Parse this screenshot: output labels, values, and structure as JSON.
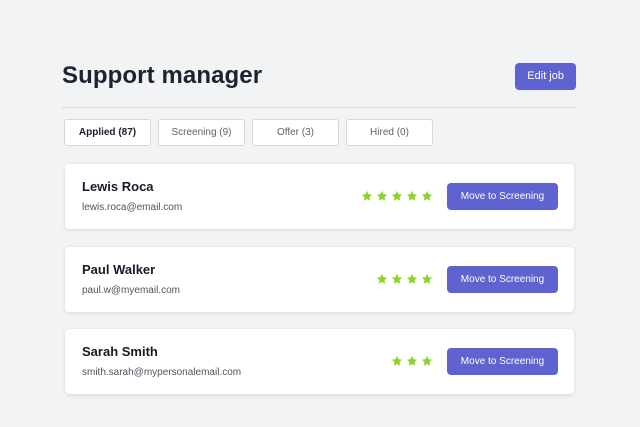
{
  "job": {
    "title": "Support manager",
    "edit_label": "Edit job"
  },
  "tabs": [
    {
      "label": "Applied (87)",
      "active": true
    },
    {
      "label": "Screening (9)",
      "active": false
    },
    {
      "label": "Offer (3)",
      "active": false
    },
    {
      "label": "Hired (0)",
      "active": false
    }
  ],
  "candidates": [
    {
      "name": "Lewis Roca",
      "email": "lewis.roca@email.com",
      "rating": 5,
      "action_label": "Move to Screening"
    },
    {
      "name": "Paul Walker",
      "email": "paul.w@myemail.com",
      "rating": 4,
      "action_label": "Move to Screening"
    },
    {
      "name": "Sarah Smith",
      "email": "smith.sarah@mypersonalemail.com",
      "rating": 3,
      "action_label": "Move to Screening"
    }
  ],
  "colors": {
    "accent": "#5f63cf",
    "star": "#8cd42a",
    "background": "#f2f3f5"
  },
  "icons": {
    "rating": "star-icon"
  }
}
